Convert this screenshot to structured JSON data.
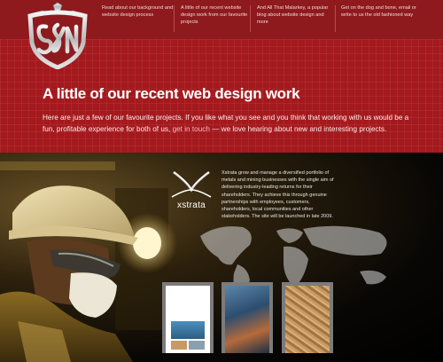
{
  "nav": {
    "items": [
      {
        "text": "Read about our background and website design process"
      },
      {
        "text": "A little of our recent website design work from our favourite projects"
      },
      {
        "text": "And All That Malarkey, a popular blog about website design and more"
      },
      {
        "text": "Get on the dog and bone, email or write to us the old fashioned way"
      }
    ]
  },
  "hero": {
    "title": "A little of our recent web design work",
    "body_before": "Here are just a few of our favourite projects. If you like what you see and you think that working with us would be a fun, profitable experience for both of us,",
    "link": "get in touch",
    "body_after": "— we love hearing about new and interesting projects."
  },
  "project": {
    "logo_text": "xstrata",
    "description": "Xstrata grow and manage a diversified portfolio of metals and mining businesses with the single aim of delivering industry-leading returns for their shareholders. They achieve this through genuine partnerships with employees, customers, shareholders, local communities and other stakeholders. The site will be launched in late 2009."
  },
  "thumbnails": [
    {
      "label": "screenshot-1"
    },
    {
      "label": "screenshot-2"
    },
    {
      "label": "screenshot-3"
    }
  ],
  "colors": {
    "brand_red": "#a4191d",
    "dark_red": "#8e1a1e",
    "link": "#f3b8bb"
  }
}
